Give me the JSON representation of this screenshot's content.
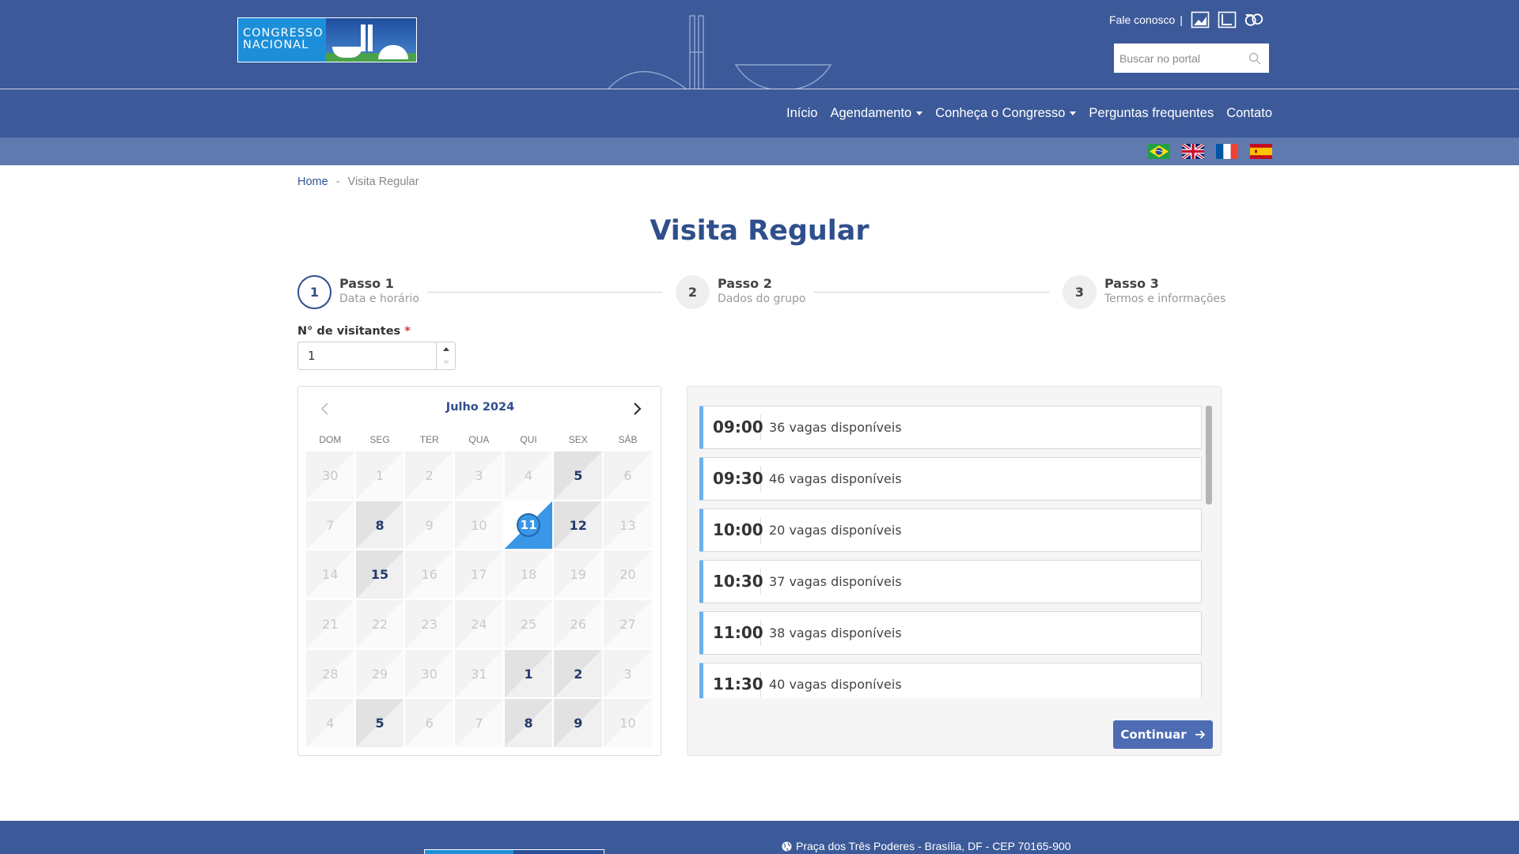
{
  "header": {
    "logo_text_line1": "CONGRESSO",
    "logo_text_line2": "NACIONAL",
    "contact_link": "Fale conosco",
    "contact_sep": "|",
    "search_placeholder": "Buscar no portal",
    "nav": [
      {
        "label": "Início"
      },
      {
        "label": "Agendamento"
      },
      {
        "label": "Conheça o Congresso"
      },
      {
        "label": "Perguntas frequentes"
      },
      {
        "label": "Contato"
      }
    ],
    "languages": [
      "pt-BR",
      "en",
      "fr",
      "es"
    ],
    "icons": [
      "contrast-icon",
      "font-size-icon",
      "sign-language-icon"
    ]
  },
  "breadcrumb": {
    "home": "Home",
    "separator": "-",
    "current": "Visita Regular"
  },
  "page_title": "Visita Regular",
  "steps": [
    {
      "number": "1",
      "title": "Passo 1",
      "subtitle": "Data e horário",
      "active": true
    },
    {
      "number": "2",
      "title": "Passo 2",
      "subtitle": "Dados do grupo",
      "active": false
    },
    {
      "number": "3",
      "title": "Passo 3",
      "subtitle": "Termos e informações",
      "active": false
    }
  ],
  "visitors": {
    "label": "N° de visitantes",
    "required_mark": "*",
    "value": "1"
  },
  "calendar": {
    "month_label": "Julho 2024",
    "weekdays": [
      "DOM",
      "SEG",
      "TER",
      "QUA",
      "QUI",
      "SEX",
      "SÁB"
    ],
    "days": [
      {
        "d": "30",
        "s": "off"
      },
      {
        "d": "1",
        "s": "off"
      },
      {
        "d": "2",
        "s": "off"
      },
      {
        "d": "3",
        "s": "off"
      },
      {
        "d": "4",
        "s": "off"
      },
      {
        "d": "5",
        "s": "avail"
      },
      {
        "d": "6",
        "s": "off"
      },
      {
        "d": "7",
        "s": "off"
      },
      {
        "d": "8",
        "s": "avail"
      },
      {
        "d": "9",
        "s": "off"
      },
      {
        "d": "10",
        "s": "off"
      },
      {
        "d": "11",
        "s": "selected"
      },
      {
        "d": "12",
        "s": "avail"
      },
      {
        "d": "13",
        "s": "off"
      },
      {
        "d": "14",
        "s": "off"
      },
      {
        "d": "15",
        "s": "avail"
      },
      {
        "d": "16",
        "s": "off"
      },
      {
        "d": "17",
        "s": "off"
      },
      {
        "d": "18",
        "s": "off"
      },
      {
        "d": "19",
        "s": "off"
      },
      {
        "d": "20",
        "s": "off"
      },
      {
        "d": "21",
        "s": "off"
      },
      {
        "d": "22",
        "s": "off"
      },
      {
        "d": "23",
        "s": "off"
      },
      {
        "d": "24",
        "s": "off"
      },
      {
        "d": "25",
        "s": "off"
      },
      {
        "d": "26",
        "s": "off"
      },
      {
        "d": "27",
        "s": "off"
      },
      {
        "d": "28",
        "s": "off"
      },
      {
        "d": "29",
        "s": "off"
      },
      {
        "d": "30",
        "s": "off"
      },
      {
        "d": "31",
        "s": "off"
      },
      {
        "d": "1",
        "s": "avail"
      },
      {
        "d": "2",
        "s": "avail"
      },
      {
        "d": "3",
        "s": "off"
      },
      {
        "d": "4",
        "s": "off"
      },
      {
        "d": "5",
        "s": "avail"
      },
      {
        "d": "6",
        "s": "off"
      },
      {
        "d": "7",
        "s": "off"
      },
      {
        "d": "8",
        "s": "avail"
      },
      {
        "d": "9",
        "s": "avail"
      },
      {
        "d": "10",
        "s": "off"
      }
    ]
  },
  "time_slots": [
    {
      "time": "09:00",
      "text": "36 vagas disponíveis"
    },
    {
      "time": "09:30",
      "text": "46 vagas disponíveis"
    },
    {
      "time": "10:00",
      "text": "20 vagas disponíveis"
    },
    {
      "time": "10:30",
      "text": "37 vagas disponíveis"
    },
    {
      "time": "11:00",
      "text": "38 vagas disponíveis"
    },
    {
      "time": "11:30",
      "text": "40 vagas disponíveis"
    }
  ],
  "continue_label": "Continuar",
  "footer": {
    "address": "Praça dos Três Poderes - Brasília, DF - CEP 70165-900"
  },
  "colors": {
    "header_bg": "#3c5a99",
    "lang_bar_bg": "#6079ae",
    "title": "#2f4f8c",
    "slot_accent": "#69b1ef",
    "selected_day": "#3a96e6",
    "button": "#4d6cb3"
  }
}
